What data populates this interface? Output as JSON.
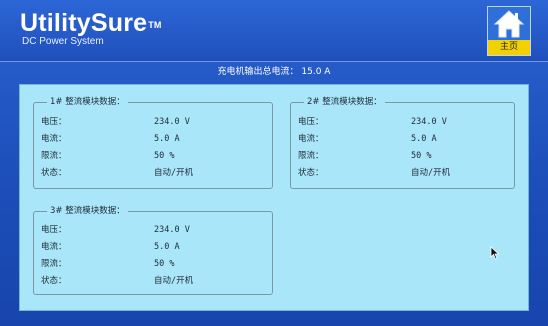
{
  "brand": {
    "name": "UtilitySure",
    "tm": "TM",
    "subtitle": "DC Power System"
  },
  "home": {
    "label": "主页",
    "icon": "home-icon"
  },
  "summary": {
    "text": "充电机输出总电流： 15.0 A"
  },
  "labels": {
    "voltage": "电压：",
    "current": "电流：",
    "limit": "限流：",
    "status": "状态："
  },
  "modules": [
    {
      "title": "1# 整流模块数据：",
      "voltage": "234.0 V",
      "current": "5.0 A",
      "limit": "50 %",
      "status": "自动/开机"
    },
    {
      "title": "2# 整流模块数据：",
      "voltage": "234.0 V",
      "current": "5.0 A",
      "limit": "50 %",
      "status": "自动/开机"
    },
    {
      "title": "3# 整流模块数据：",
      "voltage": "234.0 V",
      "current": "5.0 A",
      "limit": "50 %",
      "status": "自动/开机"
    }
  ],
  "colors": {
    "background": "#1f4fb6",
    "panel": "#a9e6f9",
    "home_label": "#f2d100"
  }
}
